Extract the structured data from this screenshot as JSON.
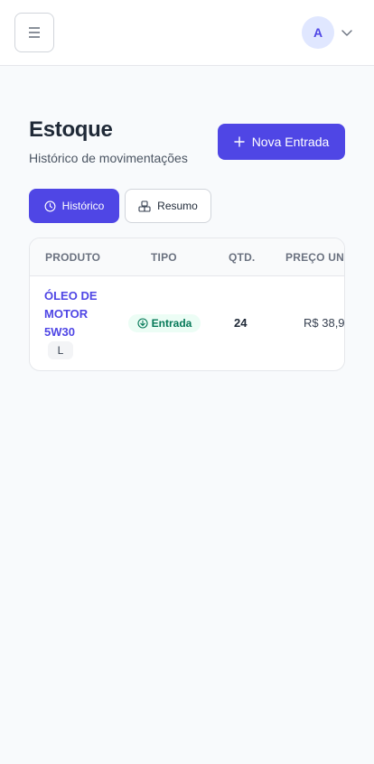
{
  "header": {
    "menu_icon": "hamburger-icon",
    "avatar_initial": "A",
    "avatar_chevron_icon": "chevron-down-icon"
  },
  "page": {
    "title": "Estoque",
    "subtitle": "Histórico de movimentações",
    "new_entry_label": "Nova Entrada",
    "new_entry_icon": "plus-icon"
  },
  "tabs": [
    {
      "label": "Histórico",
      "icon": "clock-icon",
      "active": true
    },
    {
      "label": "Resumo",
      "icon": "boxes-icon",
      "active": false
    }
  ],
  "table": {
    "columns": [
      "PRODUTO",
      "TIPO",
      "QTD.",
      "PREÇO UNI"
    ],
    "rows": [
      {
        "product": "ÓLEO DE MOTOR 5W30",
        "unit": "L",
        "type": "Entrada",
        "type_icon": "arrow-down-circle-icon",
        "quantity": "24",
        "price": "R$ 38,9"
      }
    ]
  },
  "colors": {
    "accent": "#4f46e5",
    "entrada_bg": "#ecfdf5",
    "entrada_text": "#047857",
    "background": "#f8fafc"
  }
}
